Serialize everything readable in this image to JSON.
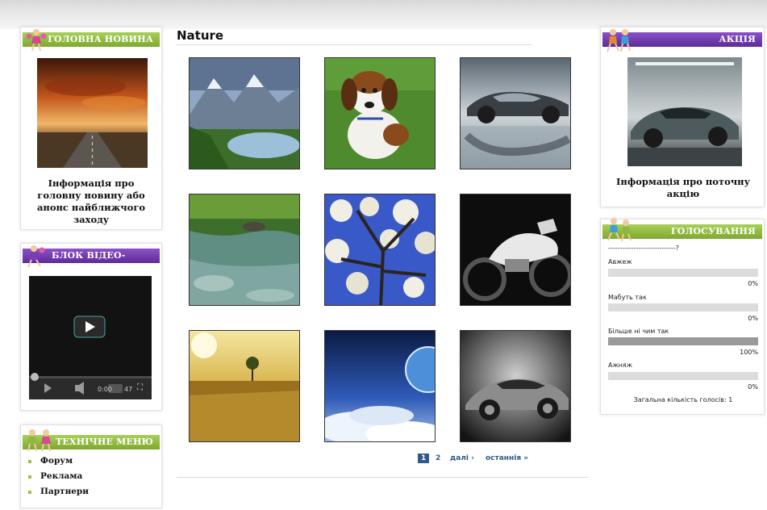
{
  "left_column": {
    "main_news": {
      "title": "ГОЛОВНА НОВИНА",
      "caption": "Інформація про головну новину або анонс найближчого заходу"
    },
    "video_ad": {
      "title": "БЛОК ВІДЕО-РЕКЛАМИ",
      "time_text": "0:00",
      "duration_text": "47"
    },
    "tech_menu": {
      "title": "ТЕХНІЧНЕ МЕНЮ",
      "items": [
        {
          "label": "Форум"
        },
        {
          "label": "Реклама"
        },
        {
          "label": "Партнери"
        }
      ]
    }
  },
  "main": {
    "title": "Nature",
    "gallery": [
      {
        "icon": "mountain-lake-photo"
      },
      {
        "icon": "beagle-dog-photo"
      },
      {
        "icon": "silver-sports-car-photo"
      },
      {
        "icon": "river-stream-photo"
      },
      {
        "icon": "blossom-tree-photo"
      },
      {
        "icon": "white-motorcycle-photo"
      },
      {
        "icon": "golden-field-photo"
      },
      {
        "icon": "planet-clouds-photo"
      },
      {
        "icon": "concept-car-photo"
      }
    ],
    "pagination": {
      "current": "1",
      "page2": "2",
      "next": "далі ›",
      "last": "останнія »"
    }
  },
  "right_column": {
    "promo": {
      "title": "АКЦІЯ",
      "caption": "Інформація про поточну акцію"
    },
    "poll": {
      "title": "ГОЛОСУВАННЯ",
      "question": "-----------------------------?",
      "options": [
        {
          "label": "Авжеж",
          "percent": 0,
          "percent_text": "0%"
        },
        {
          "label": "Мабуть так",
          "percent": 0,
          "percent_text": "0%"
        },
        {
          "label": "Більше ні чим так",
          "percent": 100,
          "percent_text": "100%"
        },
        {
          "label": "Ажняж",
          "percent": 0,
          "percent_text": "0%"
        }
      ],
      "total": "Загальна кількість голосів: 1"
    }
  },
  "colors": {
    "green_header": "#8fb841",
    "purple_header": "#6a35a8",
    "pager_active": "#2f5b8a",
    "poll_bar_bg": "#dcdcdc",
    "poll_bar_fill": "#9a9a9a"
  }
}
